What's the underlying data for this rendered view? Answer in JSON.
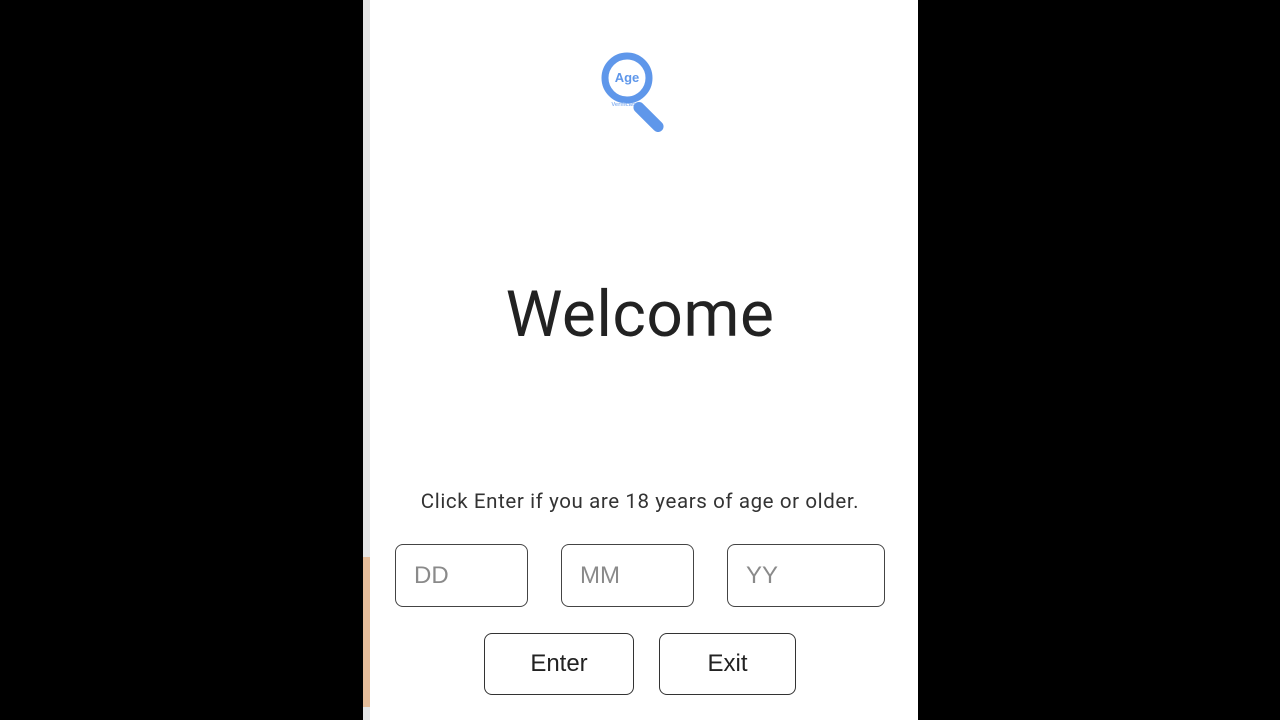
{
  "logo": {
    "topText": "Age",
    "bottomText": "Verification"
  },
  "heading": "Welcome",
  "subtext": "Click Enter if you are 18 years of age or older.",
  "dateInputs": {
    "dayPlaceholder": "DD",
    "monthPlaceholder": "MM",
    "yearPlaceholder": "YY"
  },
  "buttons": {
    "enter": "Enter",
    "exit": "Exit"
  }
}
